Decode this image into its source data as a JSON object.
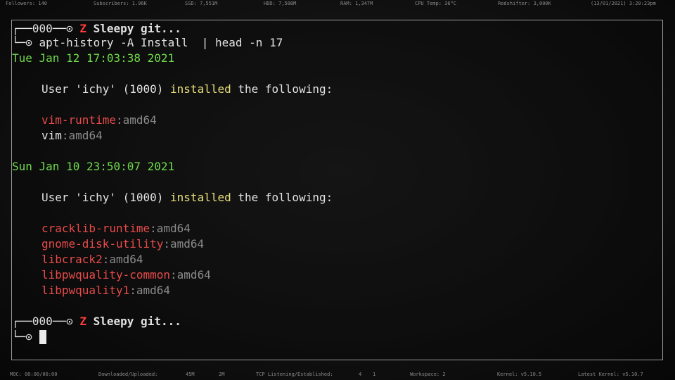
{
  "topbar": {
    "followers": "Followers: 140",
    "subscribers": "Subscribers: 1.96K",
    "ssd": "SSD:   7,551M",
    "hdd": "HDD:   7,588M",
    "ram": "RAM: 1,347M",
    "cpu_temp": "CPU Temp:   36°C",
    "redshifter": "Redshifter:  3,000K",
    "datetime": "(13/01/2021)  3:20:23pm"
  },
  "bottombar": {
    "moc": "MOC: 00:00/00:00",
    "downloaded_label": "Downloaded/Uploaded:",
    "downloaded": "45M",
    "uploaded": "2M",
    "tcp_label": "TCP Listening/Established:",
    "tcp_listening": "4",
    "tcp_established": "1",
    "workspace": "Workspace:  2",
    "kernel": "Kernel:  v5.10.5",
    "latest_kernel": "Latest Kernel:  v5.10.7"
  },
  "terminal": {
    "prompt": {
      "frame_top": "┌──000──⊙",
      "frame_bottom": "└─⊙",
      "z_icon": "Z",
      "title": "Sleepy git..."
    },
    "command": "apt-history -A Install  | head -n 17",
    "entries": [
      {
        "date": "Tue Jan 12 17:03:38 2021",
        "user_pre": "User 'ichy' (1000) ",
        "action": "installed",
        "user_post": " the following:",
        "packages": [
          {
            "name": "vim-runtime",
            "arch": ":amd64"
          },
          {
            "name": "vim",
            "arch": ":amd64"
          }
        ]
      },
      {
        "date": "Sun Jan 10 23:50:07 2021",
        "user_pre": "User 'ichy' (1000) ",
        "action": "installed",
        "user_post": " the following:",
        "packages": [
          {
            "name": "cracklib-runtime",
            "arch": ":amd64"
          },
          {
            "name": "gnome-disk-utility",
            "arch": ":amd64"
          },
          {
            "name": "libcrack2",
            "arch": ":amd64"
          },
          {
            "name": "libpwquality-common",
            "arch": ":amd64"
          },
          {
            "name": "libpwquality1",
            "arch": ":amd64"
          }
        ]
      }
    ]
  }
}
